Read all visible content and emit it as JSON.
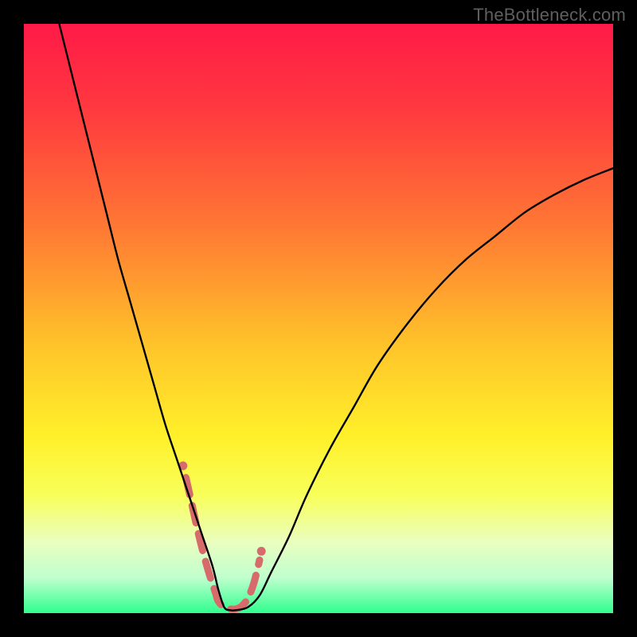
{
  "watermark": "TheBottleneck.com",
  "colors": {
    "frame": "#000000",
    "curve": "#000000",
    "dashed": "#d76a6a",
    "gradient_stops": [
      {
        "offset": 0.0,
        "color": "#ff1a47"
      },
      {
        "offset": 0.15,
        "color": "#ff3a3f"
      },
      {
        "offset": 0.35,
        "color": "#ff7a33"
      },
      {
        "offset": 0.55,
        "color": "#ffc52a"
      },
      {
        "offset": 0.7,
        "color": "#fff02a"
      },
      {
        "offset": 0.8,
        "color": "#f8ff5a"
      },
      {
        "offset": 0.88,
        "color": "#eafec0"
      },
      {
        "offset": 0.94,
        "color": "#bfffce"
      },
      {
        "offset": 1.0,
        "color": "#2fff8e"
      }
    ]
  },
  "chart_data": {
    "type": "line",
    "title": "",
    "xlabel": "",
    "ylabel": "",
    "xlim": [
      0,
      100
    ],
    "ylim": [
      0,
      100
    ],
    "series": [
      {
        "name": "bottleneck-curve",
        "x": [
          6,
          8,
          10,
          12,
          14,
          16,
          18,
          20,
          22,
          24,
          26,
          28,
          30,
          32,
          33,
          34,
          35,
          36,
          38,
          40,
          42,
          45,
          48,
          52,
          56,
          60,
          65,
          70,
          75,
          80,
          85,
          90,
          95,
          100
        ],
        "y": [
          100,
          92,
          84,
          76,
          68,
          60,
          53,
          46,
          39,
          32,
          26,
          20,
          14,
          8,
          4,
          1,
          0.5,
          0.5,
          1,
          3,
          7,
          13,
          20,
          28,
          35,
          42,
          49,
          55,
          60,
          64,
          68,
          71,
          73.5,
          75.5
        ]
      }
    ],
    "dashed_highlight": {
      "comment": "Approximate segment near the curve bottom drawn as salmon dashes",
      "x": [
        27.5,
        28.5,
        29.5,
        30.5,
        31.5,
        32.5,
        33.0,
        34.0,
        35.0,
        36.0,
        37.0,
        38.0,
        39.0,
        40.0
      ],
      "y": [
        23.0,
        18.5,
        14.0,
        10.0,
        6.5,
        3.5,
        2.0,
        1.0,
        0.7,
        0.7,
        1.2,
        2.5,
        5.0,
        9.0
      ]
    },
    "dashed_dots": {
      "x": [
        27.0,
        40.3
      ],
      "y": [
        25.0,
        10.5
      ]
    }
  }
}
